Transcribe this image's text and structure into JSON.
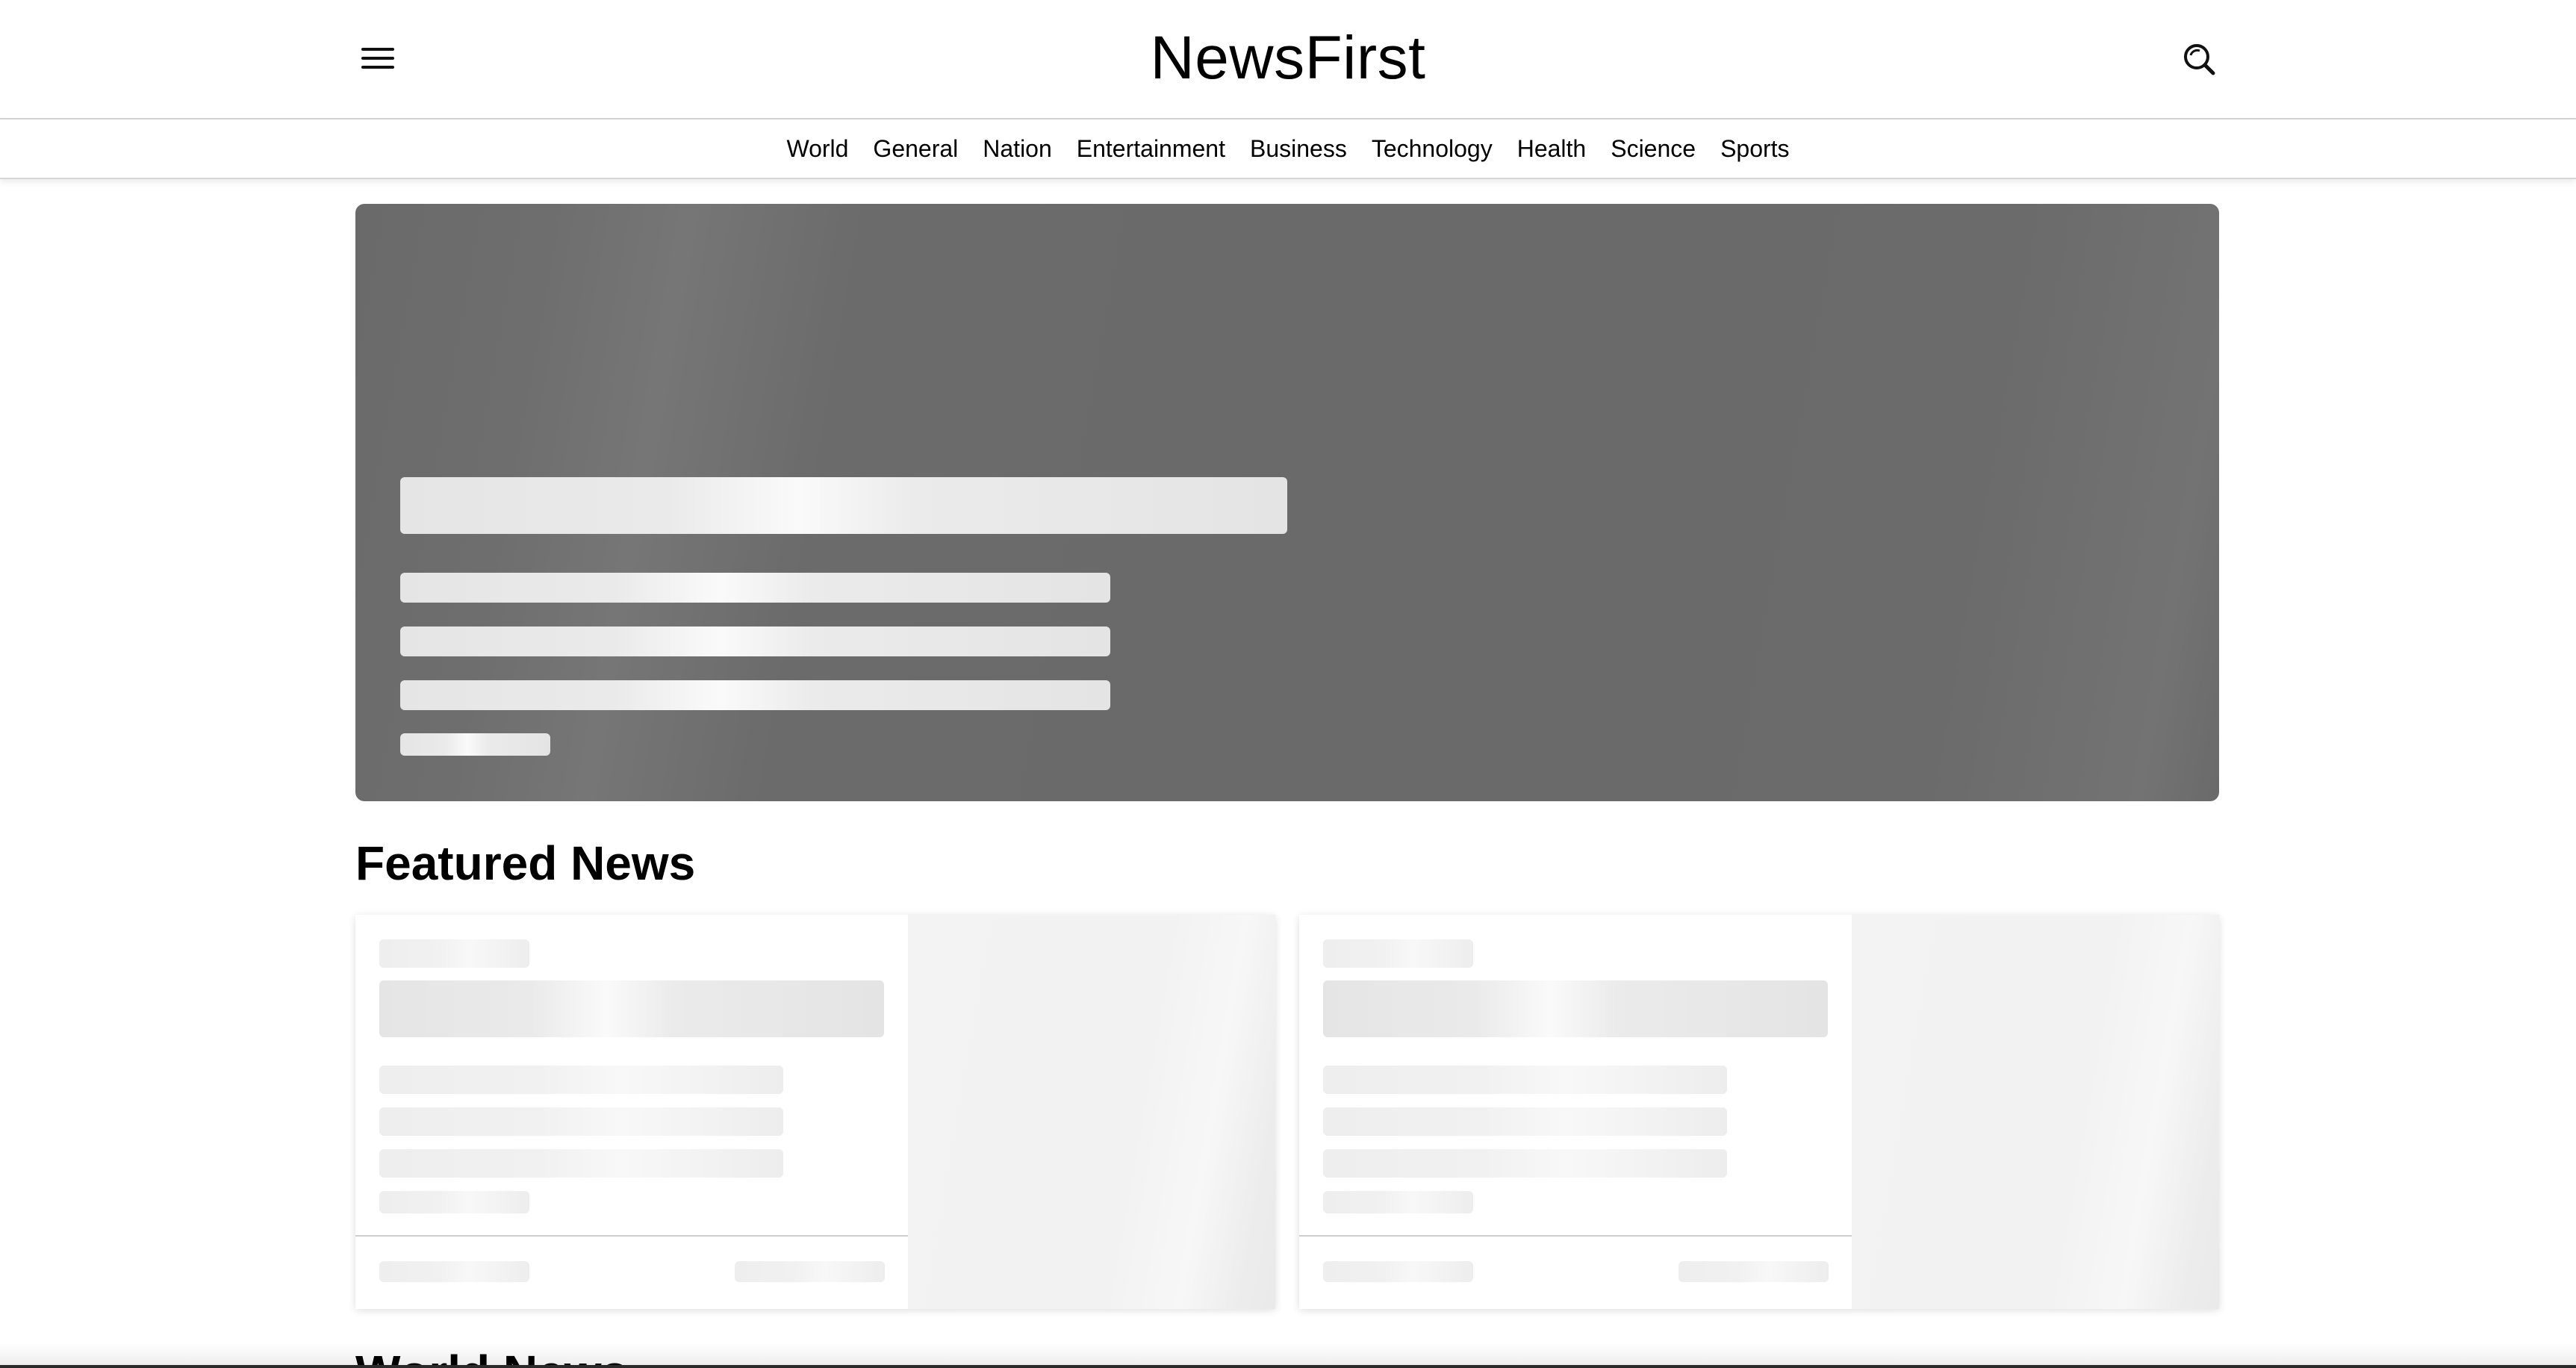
{
  "header": {
    "logo": "NewsFirst",
    "menu_icon": "hamburger-menu-icon",
    "search_icon": "search-icon"
  },
  "categories": [
    "World",
    "General",
    "Nation",
    "Entertainment",
    "Business",
    "Technology",
    "Health",
    "Science",
    "Sports"
  ],
  "sections": {
    "featured_title": "Featured News",
    "world_title": "World News"
  },
  "state": {
    "loading": "skeleton placeholders"
  },
  "colors": {
    "background": "#ffffff",
    "hero_skeleton": "#6a6a6a",
    "skeleton_light": "#e5e5e5",
    "skeleton_pale": "#efefef",
    "text": "#000000"
  }
}
